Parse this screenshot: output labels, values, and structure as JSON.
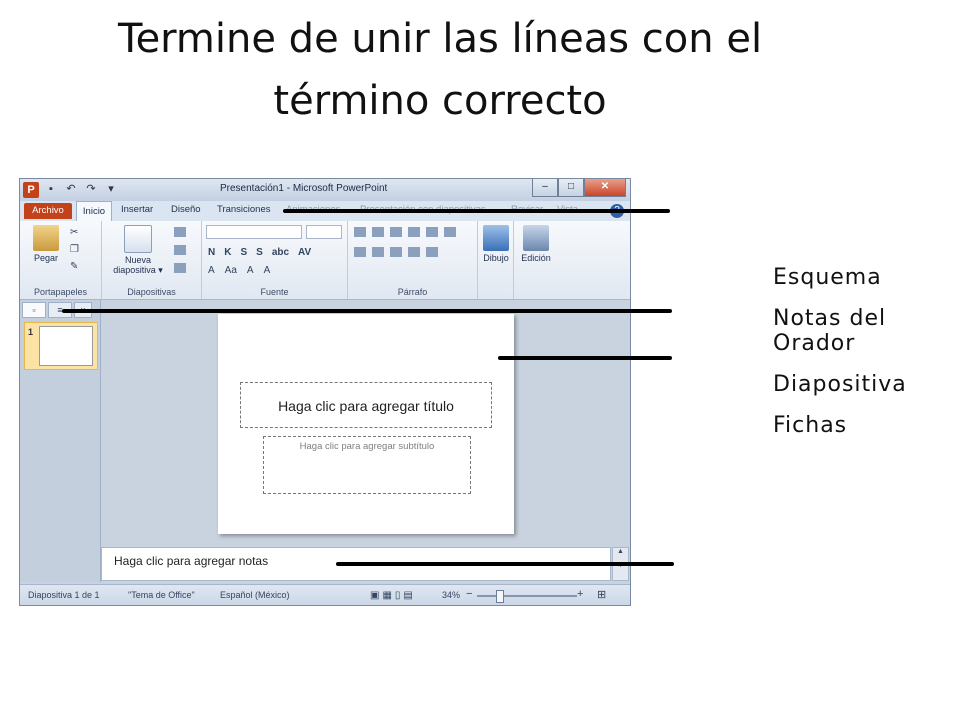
{
  "slide_title": {
    "line1": "Termine de unir las líneas con el",
    "line2": "término correcto"
  },
  "window": {
    "title": "Presentación1 - Microsoft PowerPoint",
    "app_icon": "P",
    "buttons": {
      "minimize": "–",
      "maximize": "□",
      "close": "✕"
    },
    "help": "?"
  },
  "ribbon_tabs": {
    "file": "Archivo",
    "home": "Inicio",
    "insert": "Insertar",
    "design": "Diseño",
    "transitions": "Transiciones",
    "animations": "Animaciones",
    "slideshow": "Presentación con diapositivas",
    "review": "Revisar",
    "view": "Vista"
  },
  "ribbon": {
    "paste": "Pegar",
    "new_slide_1": "Nueva",
    "new_slide_2": "diapositiva ▾",
    "draw": "Dibujo",
    "edit": "Edición",
    "groups": {
      "clipboard": "Portapapeles",
      "slides": "Diapositivas",
      "font": "Fuente",
      "paragraph": "Párrafo"
    },
    "font_buttons": [
      "N",
      "K",
      "S",
      "S",
      "abc",
      "AV"
    ],
    "font_buttons2": [
      "A",
      "Aa",
      "A",
      "A"
    ]
  },
  "slide_panel": {
    "thumb_number": "1"
  },
  "slide": {
    "title_placeholder": "Haga clic para agregar título",
    "subtitle_placeholder": "Haga clic para agregar subtítulo"
  },
  "notes": {
    "placeholder": "Haga clic para agregar notas"
  },
  "statusbar": {
    "slide_counter": "Diapositiva 1 de 1",
    "theme": "\"Tema de Office\"",
    "language": "Español (México)",
    "zoom": "34%",
    "zoom_minus": "−",
    "zoom_plus": "+"
  },
  "answers": [
    "Esquema",
    "Notas del",
    "Orador",
    "Diapositiva",
    "Fichas"
  ],
  "icons": {
    "app": "powerpoint-icon",
    "save": "save-icon",
    "undo": "undo-icon",
    "redo": "redo-icon"
  },
  "colors": {
    "file_tab": "#c4421a",
    "ribbon_bg": "#e1e8f2",
    "selected_thumb": "#fbe3a5"
  }
}
